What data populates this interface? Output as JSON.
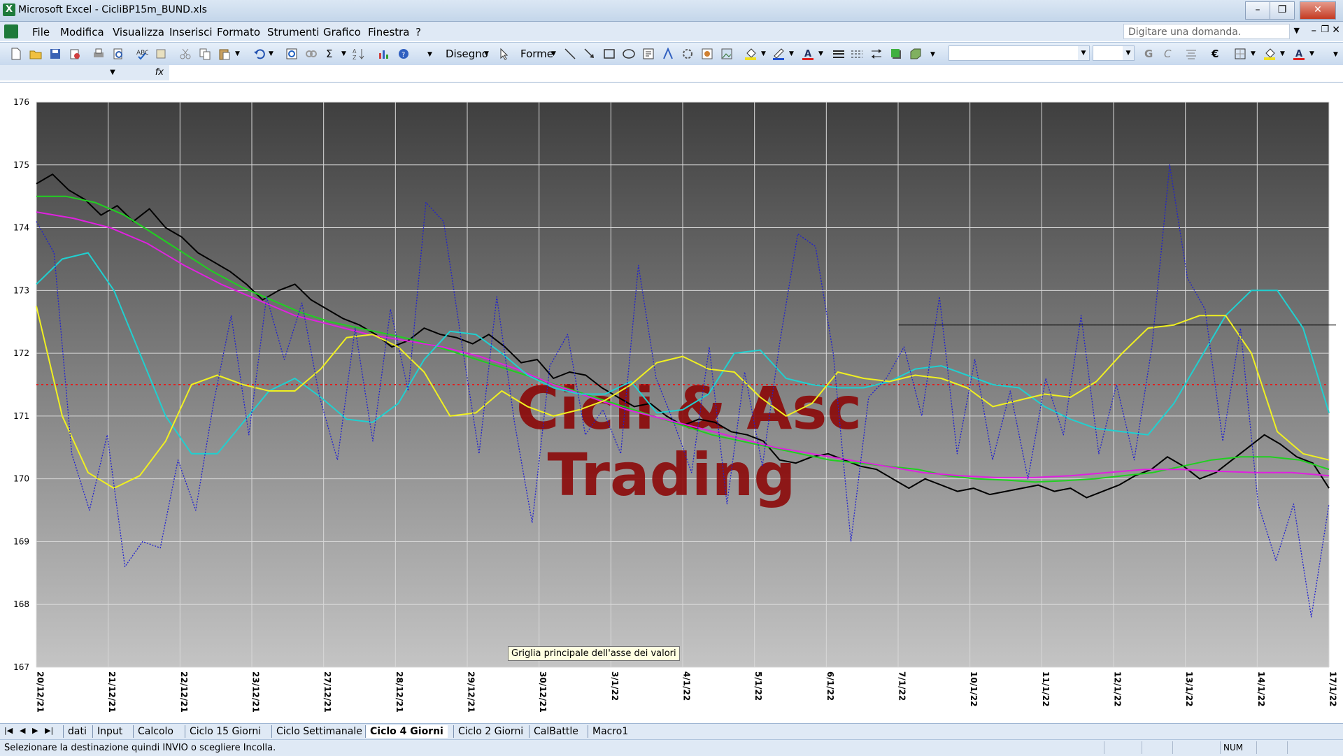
{
  "window": {
    "app": "Microsoft Excel",
    "title": "Microsoft Excel - CicliBP15m_BUND.xls",
    "minimize": "–",
    "restore": "❐",
    "close": "✕"
  },
  "menu": {
    "items": [
      "File",
      "Modifica",
      "Visualizza",
      "Inserisci",
      "Formato",
      "Strumenti",
      "Grafico",
      "Finestra",
      "?"
    ],
    "question_placeholder": "Digitare una domanda."
  },
  "toolbar": {
    "draw_label": "Disegno",
    "shapes_label": "Forme"
  },
  "formula_bar": {
    "fx": "fx"
  },
  "chart_data": {
    "type": "line",
    "title": "",
    "watermark": [
      "Cicli & Asc",
      "Trading"
    ],
    "ylim": [
      167,
      176
    ],
    "y_ticks": [
      "167",
      "168",
      "169",
      "170",
      "171",
      "172",
      "173",
      "174",
      "175",
      "176"
    ],
    "x_ticks": [
      "20/12/21",
      "21/12/21",
      "22/12/21",
      "23/12/21",
      "27/12/21",
      "28/12/21",
      "29/12/21",
      "30/12/21",
      "3/1/22",
      "4/1/22",
      "5/1/22",
      "6/1/22",
      "7/1/22",
      "10/1/22",
      "11/1/22",
      "12/1/22",
      "13/1/22",
      "14/1/22",
      "17/1/22"
    ],
    "grid": true,
    "reference_line": {
      "value": 171.5,
      "color": "#e02020",
      "style": "dotted"
    },
    "level_line": {
      "value": 172.45,
      "from_index": 1.25,
      "color": "#000000"
    },
    "series": [
      {
        "color": "#000000",
        "values": [
          174.7,
          174.85,
          174.6,
          174.45,
          174.2,
          174.35,
          174.1,
          174.3,
          174.0,
          173.85,
          173.6,
          173.45,
          173.3,
          173.1,
          172.85,
          173.0,
          173.1,
          172.85,
          172.7,
          172.55,
          172.45,
          172.3,
          172.1,
          172.2,
          172.4,
          172.3,
          172.25,
          172.15,
          172.3,
          172.1,
          171.85,
          171.9,
          171.6,
          171.7,
          171.65,
          171.45,
          171.3,
          171.15,
          171.2,
          171.0,
          170.85,
          170.95,
          170.9,
          170.75,
          170.7,
          170.6,
          170.3,
          170.25,
          170.35,
          170.4,
          170.3,
          170.2,
          170.15,
          170.0,
          169.85,
          170.0,
          169.9,
          169.8,
          169.85,
          169.75,
          169.8,
          169.85,
          169.9,
          169.8,
          169.85,
          169.7,
          169.8,
          169.9,
          170.05,
          170.15,
          170.35,
          170.2,
          170.0,
          170.1,
          170.3,
          170.5,
          170.7,
          170.55,
          170.35,
          170.25,
          169.85
        ]
      },
      {
        "color": "#20d020",
        "values": [
          174.5,
          174.5,
          174.4,
          174.2,
          173.9,
          173.6,
          173.3,
          173.05,
          172.85,
          172.65,
          172.5,
          172.4,
          172.3,
          172.2,
          172.05,
          171.9,
          171.75,
          171.6,
          171.45,
          171.3,
          171.15,
          171.0,
          170.85,
          170.7,
          170.6,
          170.5,
          170.4,
          170.3,
          170.25,
          170.2,
          170.15,
          170.05,
          170.0,
          169.98,
          169.95,
          169.97,
          170.0,
          170.05,
          170.1,
          170.2,
          170.3,
          170.35,
          170.35,
          170.3,
          170.15
        ]
      },
      {
        "color": "#e020e0",
        "values": [
          174.25,
          174.15,
          174.0,
          173.75,
          173.4,
          173.1,
          172.85,
          172.6,
          172.45,
          172.3,
          172.2,
          172.1,
          171.95,
          171.75,
          171.5,
          171.3,
          171.1,
          170.95,
          170.8,
          170.65,
          170.5,
          170.4,
          170.3,
          170.2,
          170.1,
          170.05,
          170.02,
          170.02,
          170.05,
          170.1,
          170.15,
          170.15,
          170.12,
          170.1,
          170.1,
          170.05
        ]
      },
      {
        "color": "#20d0d0",
        "values": [
          173.1,
          173.5,
          173.6,
          173.0,
          172.0,
          171.0,
          170.4,
          170.4,
          170.9,
          171.4,
          171.6,
          171.3,
          170.95,
          170.9,
          171.2,
          171.9,
          172.35,
          172.3,
          172.0,
          171.65,
          171.45,
          171.35,
          171.35,
          171.55,
          171.05,
          171.1,
          171.35,
          172.0,
          172.05,
          171.6,
          171.5,
          171.45,
          171.45,
          171.55,
          171.75,
          171.8,
          171.65,
          171.5,
          171.45,
          171.15,
          170.95,
          170.8,
          170.75,
          170.7,
          171.2,
          171.9,
          172.6,
          173.0,
          173.0,
          172.4,
          171.05
        ]
      },
      {
        "color": "#f0f020",
        "values": [
          172.75,
          171.0,
          170.1,
          169.85,
          170.05,
          170.6,
          171.5,
          171.65,
          171.5,
          171.4,
          171.4,
          171.75,
          172.25,
          172.3,
          172.1,
          171.7,
          171.0,
          171.05,
          171.4,
          171.15,
          171.0,
          171.1,
          171.25,
          171.5,
          171.85,
          171.95,
          171.75,
          171.7,
          171.3,
          171.0,
          171.2,
          171.7,
          171.6,
          171.55,
          171.65,
          171.6,
          171.45,
          171.15,
          171.25,
          171.35,
          171.3,
          171.55,
          172.0,
          172.4,
          172.45,
          172.6,
          172.6,
          172.0,
          170.75,
          170.4,
          170.3
        ]
      },
      {
        "color": "#2020d0",
        "values": [
          174.1,
          173.6,
          170.4,
          169.5,
          170.7,
          168.6,
          169.0,
          168.9,
          170.3,
          169.5,
          171.2,
          172.6,
          170.7,
          172.9,
          171.9,
          172.8,
          171.3,
          170.3,
          172.4,
          170.6,
          172.7,
          171.4,
          174.4,
          174.1,
          172.2,
          170.4,
          172.9,
          170.9,
          169.3,
          171.8,
          172.3,
          170.7,
          171.1,
          170.4,
          173.4,
          171.6,
          170.9,
          170.1,
          172.1,
          169.6,
          171.7,
          170.2,
          172.2,
          173.9,
          173.7,
          172.0,
          169.0,
          171.3,
          171.6,
          172.1,
          171.0,
          172.9,
          170.4,
          171.9,
          170.3,
          171.4,
          170.0,
          171.6,
          170.7,
          172.6,
          170.4,
          171.5,
          170.3,
          172.1,
          175.0,
          173.2,
          172.7,
          170.6,
          172.4,
          169.6,
          168.7,
          169.6,
          167.8,
          169.6
        ]
      }
    ]
  },
  "tooltip": "Griglia principale dell'asse dei valori",
  "sheets": {
    "tabs": [
      "dati",
      "Input",
      "Calcolo",
      "Ciclo 15 Giorni",
      "Ciclo Settimanale",
      "Ciclo 4 Giorni",
      "Ciclo 2 Giorni",
      "CalBattle",
      "Macro1"
    ],
    "active": "Ciclo 4 Giorni"
  },
  "status": {
    "message": "Selezionare la destinazione quindi INVIO o scegliere Incolla.",
    "num": "NUM"
  }
}
